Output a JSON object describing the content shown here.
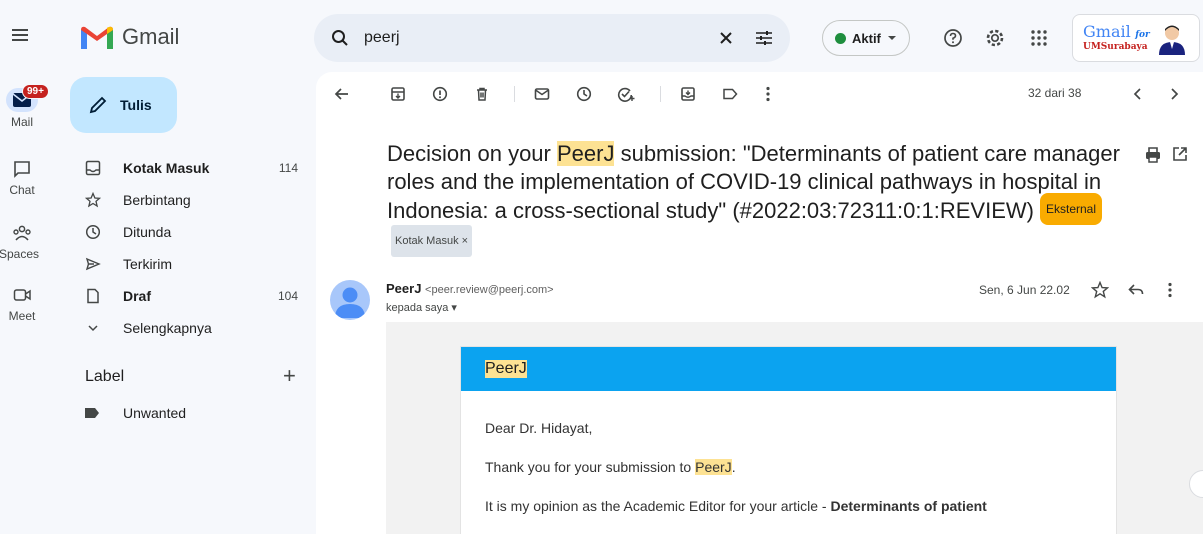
{
  "app": {
    "name": "Gmail"
  },
  "rail": {
    "badge": "99+",
    "items": [
      {
        "label": "Mail",
        "icon": "mail-icon"
      },
      {
        "label": "Chat",
        "icon": "chat-icon"
      },
      {
        "label": "Spaces",
        "icon": "spaces-icon"
      },
      {
        "label": "Meet",
        "icon": "meet-icon"
      }
    ]
  },
  "compose": {
    "label": "Tulis"
  },
  "nav": {
    "items": [
      {
        "label": "Kotak Masuk",
        "count": "114",
        "icon": "inbox-icon"
      },
      {
        "label": "Berbintang",
        "count": "",
        "icon": "star-icon"
      },
      {
        "label": "Ditunda",
        "count": "",
        "icon": "clock-icon"
      },
      {
        "label": "Terkirim",
        "count": "",
        "icon": "send-icon"
      },
      {
        "label": "Draf",
        "count": "104",
        "icon": "draft-icon"
      },
      {
        "label": "Selengkapnya",
        "count": "",
        "icon": "chevron-down-icon"
      }
    ],
    "label_heading": "Label",
    "labels": [
      {
        "label": "Unwanted",
        "icon": "label-icon"
      }
    ]
  },
  "search": {
    "value": "peerj"
  },
  "status": {
    "label": "Aktif"
  },
  "brand": {
    "line1": "Gmail",
    "line1_suffix": "for",
    "line2": "UMSurabaya"
  },
  "pager": {
    "text": "32 dari 38"
  },
  "email": {
    "subject_pre": "Decision on your ",
    "subject_hl": "PeerJ",
    "subject_post": " submission: \"Determinants of patient care manager roles and the implementation of COVID-19 clinical pathways in hospital in Indonesia: a cross-sectional study\" (#2022:03:72311:0:1:REVIEW)",
    "chip_external": "Eksternal",
    "chip_inbox": "Kotak Masuk ×",
    "sender_name": "PeerJ",
    "sender_email": "<peer.review@peerj.com>",
    "to": "kepada saya ▾",
    "date": "Sen, 6 Jun 22.02",
    "card_header": "PeerJ",
    "greeting": "Dear Dr. Hidayat,",
    "line2_pre": "Thank you for your submission to ",
    "line2_hl": "PeerJ",
    "line2_post": ".",
    "line3_pre": "It is my opinion as the Academic Editor for your article - ",
    "line3_bold": "Determinants of patient"
  },
  "colors": {
    "accent": "#0ba3f0",
    "compose": "#c2e7ff",
    "badge": "#c5221f",
    "highlight": "#fde293",
    "external": "#f9ab00"
  }
}
